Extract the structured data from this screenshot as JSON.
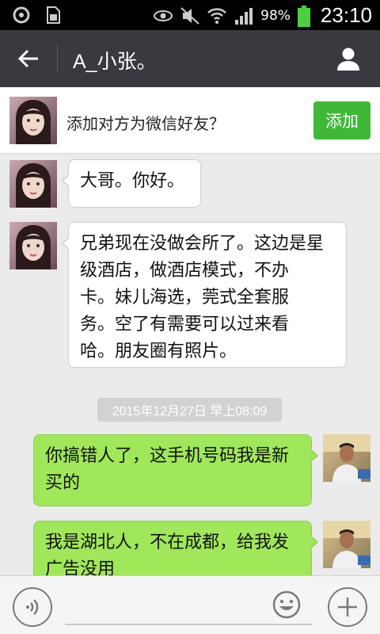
{
  "status_bar": {
    "battery_percent": "98%",
    "time": "23:10",
    "icons": [
      "settings-gear-icon",
      "sim-card-icon",
      "eye-icon",
      "mute-icon",
      "wifi-icon",
      "signal-icon",
      "battery-icon"
    ]
  },
  "header": {
    "title": "A_小张。",
    "back_icon": "arrow-left-icon",
    "profile_icon": "person-icon"
  },
  "add_friend_banner": {
    "prompt": "添加对方为微信好友？",
    "button_label": "添加"
  },
  "messages": [
    {
      "direction": "incoming",
      "lines": [
        "大哥。你好。"
      ]
    },
    {
      "direction": "incoming",
      "lines": [
        "兄弟现在没做会所了。这边是星",
        "级酒店，做酒店模式，不办",
        "卡。妹儿海选，莞式全套服",
        "务。空了有需要可以过来看",
        "哈。朋友圈有照片。"
      ]
    },
    {
      "direction": "outgoing",
      "lines": [
        "你搞错人了，这手机号码我是新",
        "买的"
      ]
    },
    {
      "direction": "outgoing",
      "lines": [
        "我是湖北人，不在成都，给我发",
        "广告没用"
      ]
    }
  ],
  "timestamp": "2015年12月27日 早上08:09",
  "input_bar": {
    "placeholder": "",
    "voice_icon": "voice-icon",
    "emoji_icon": "emoji-icon",
    "plus_icon": "plus-icon"
  },
  "colors": {
    "header_bg": "#393a3f",
    "chat_bg": "#ebebeb",
    "outgoing_bubble": "#a0e75a",
    "incoming_bubble": "#ffffff",
    "add_button": "#3fb838"
  }
}
